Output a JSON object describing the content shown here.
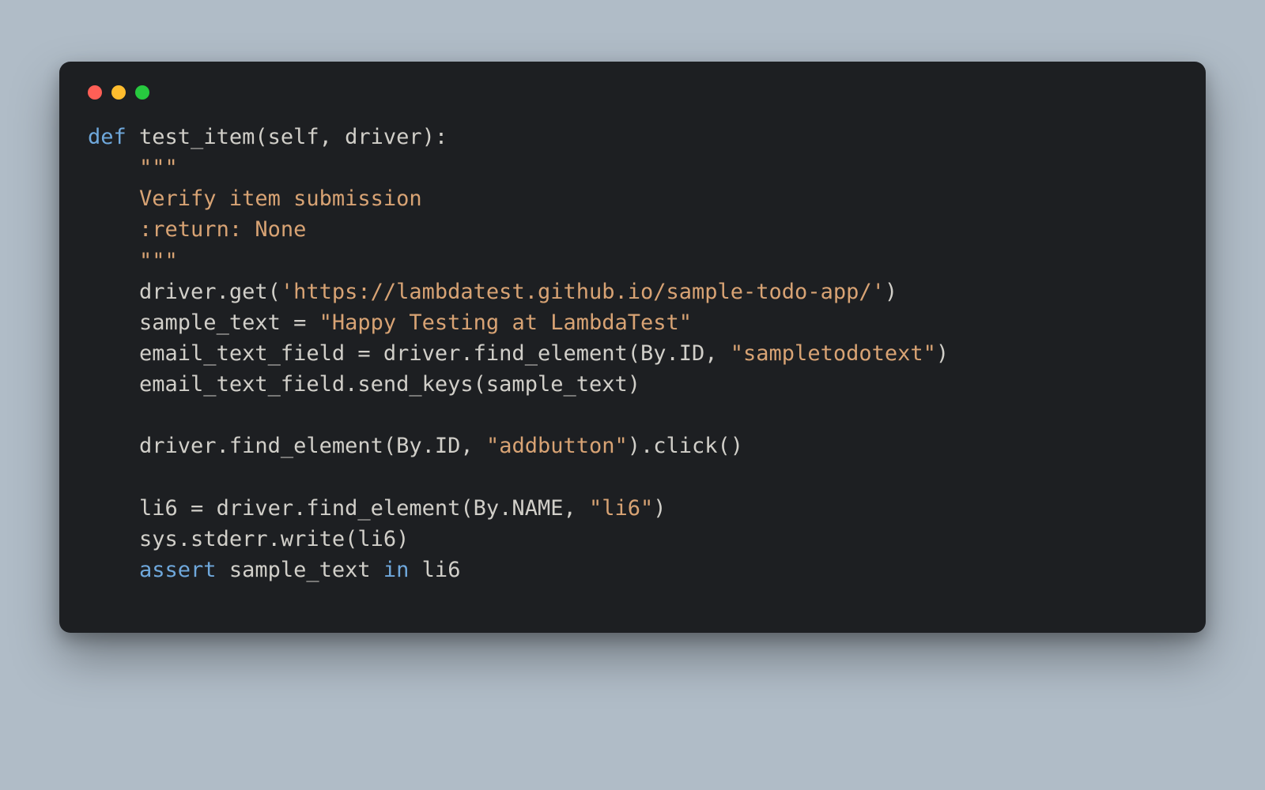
{
  "code": {
    "lines": [
      {
        "indent": 0,
        "tokens": [
          {
            "cls": "tok-kw",
            "text": "def"
          },
          {
            "cls": "tok-def",
            "text": " test_item(self, driver):"
          }
        ]
      },
      {
        "indent": 1,
        "tokens": [
          {
            "cls": "tok-str",
            "text": "\"\"\""
          }
        ]
      },
      {
        "indent": 1,
        "tokens": [
          {
            "cls": "tok-str",
            "text": "Verify item submission"
          }
        ]
      },
      {
        "indent": 1,
        "tokens": [
          {
            "cls": "tok-str",
            "text": ":return: None"
          }
        ]
      },
      {
        "indent": 1,
        "tokens": [
          {
            "cls": "tok-str",
            "text": "\"\"\""
          }
        ]
      },
      {
        "indent": 1,
        "tokens": [
          {
            "cls": "tok-def",
            "text": "driver.get("
          },
          {
            "cls": "tok-str",
            "text": "'https://lambdatest.github.io/sample-todo-app/'"
          },
          {
            "cls": "tok-def",
            "text": ")"
          }
        ]
      },
      {
        "indent": 1,
        "tokens": [
          {
            "cls": "tok-def",
            "text": "sample_text = "
          },
          {
            "cls": "tok-str",
            "text": "\"Happy Testing at LambdaTest\""
          }
        ]
      },
      {
        "indent": 1,
        "tokens": [
          {
            "cls": "tok-def",
            "text": "email_text_field = driver.find_element(By.ID, "
          },
          {
            "cls": "tok-str",
            "text": "\"sampletodotext\""
          },
          {
            "cls": "tok-def",
            "text": ")"
          }
        ]
      },
      {
        "indent": 1,
        "tokens": [
          {
            "cls": "tok-def",
            "text": "email_text_field.send_keys(sample_text)"
          }
        ]
      },
      {
        "indent": 1,
        "tokens": [
          {
            "cls": "tok-def",
            "text": ""
          }
        ]
      },
      {
        "indent": 1,
        "tokens": [
          {
            "cls": "tok-def",
            "text": "driver.find_element(By.ID, "
          },
          {
            "cls": "tok-str",
            "text": "\"addbutton\""
          },
          {
            "cls": "tok-def",
            "text": ").click()"
          }
        ]
      },
      {
        "indent": 1,
        "tokens": [
          {
            "cls": "tok-def",
            "text": ""
          }
        ]
      },
      {
        "indent": 1,
        "tokens": [
          {
            "cls": "tok-def",
            "text": "li6 = driver.find_element(By.NAME, "
          },
          {
            "cls": "tok-str",
            "text": "\"li6\""
          },
          {
            "cls": "tok-def",
            "text": ")"
          }
        ]
      },
      {
        "indent": 1,
        "tokens": [
          {
            "cls": "tok-def",
            "text": "sys.stderr.write(li6)"
          }
        ]
      },
      {
        "indent": 1,
        "tokens": [
          {
            "cls": "tok-kw",
            "text": "assert"
          },
          {
            "cls": "tok-def",
            "text": " sample_text "
          },
          {
            "cls": "tok-kw",
            "text": "in"
          },
          {
            "cls": "tok-def",
            "text": " li6"
          }
        ]
      }
    ],
    "indent_unit": "    "
  }
}
